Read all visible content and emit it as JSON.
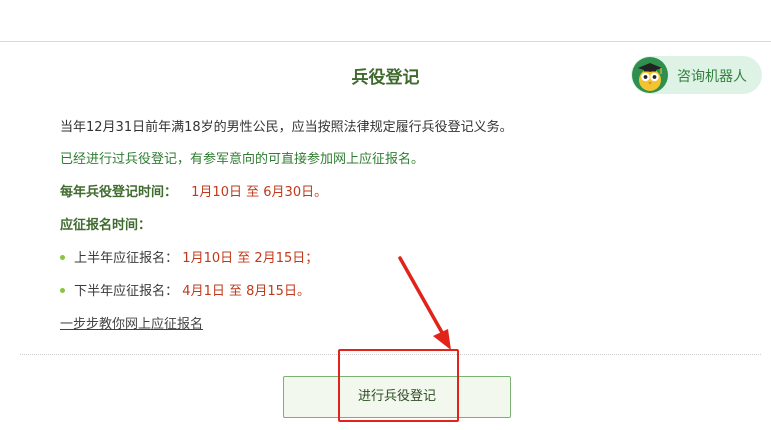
{
  "page": {
    "title": "兵役登记",
    "robot_label": "咨询机器人",
    "intro": "当年12月31日前年满18岁的男性公民，应当按照法律规定履行兵役登记义务。",
    "online_note": "已经进行过兵役登记，有参军意向的可直接参加网上应征报名。",
    "registration_period": {
      "label": "每年兵役登记时间：",
      "start": "1月10日",
      "separator": "至",
      "end": "6月30日。"
    },
    "apply_period_label": "应征报名时间：",
    "first_half": {
      "label": "上半年应征报名：",
      "start": "1月10日",
      "separator": "至",
      "end": "2月15日；"
    },
    "second_half": {
      "label": "下半年应征报名：",
      "start": "4月1日",
      "separator": "至",
      "end": "8月15日。"
    },
    "guide_link": "一步步教你网上应征报名",
    "main_button": "进行兵役登记"
  },
  "colors": {
    "title_green": "#3f6b2e",
    "link_green": "#2f7d32",
    "date_red": "#c0391b",
    "button_border": "#7bb272",
    "annotation_red": "#e2231a",
    "robot_bg": "#def3e6"
  },
  "icons": {
    "robot_avatar": "robot-avatar-icon",
    "bullet": "bullet-dot-icon"
  }
}
